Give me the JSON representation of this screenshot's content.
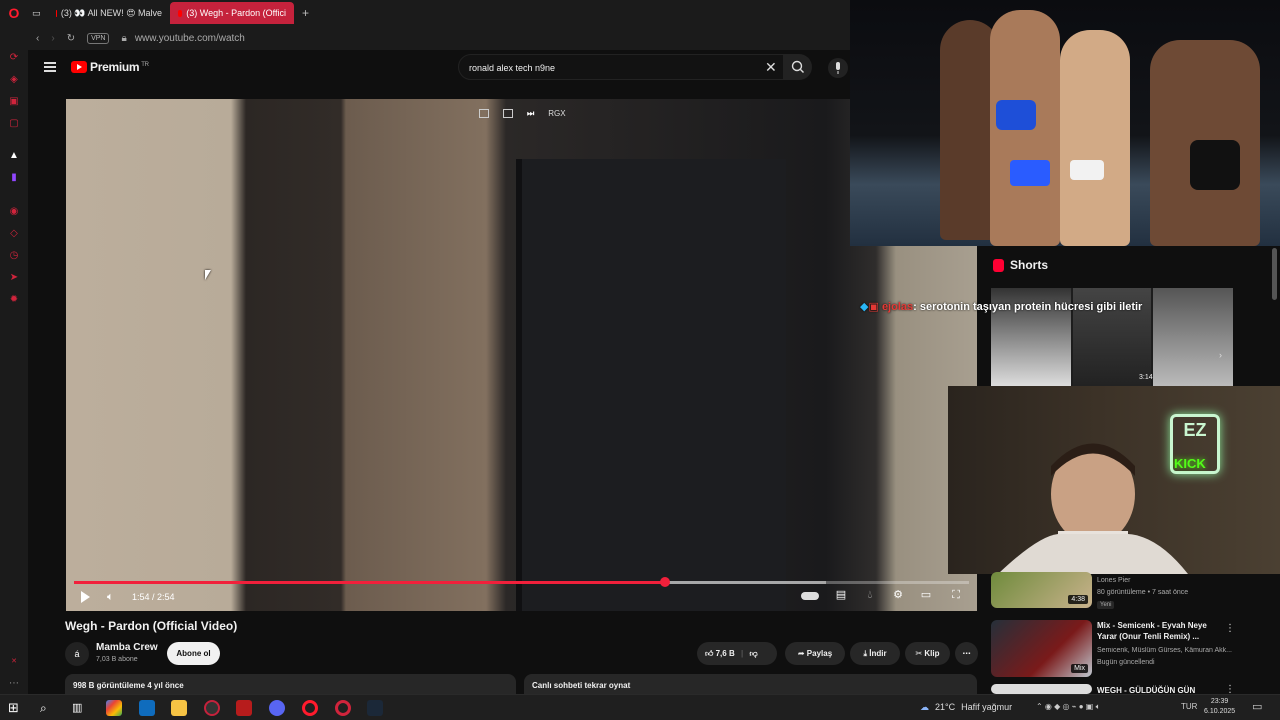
{
  "browser": {
    "tabs": [
      {
        "label": "(3) 👀 All NEW! 😍 Malve"
      },
      {
        "label": "(3) Wegh - Pardon (Offici"
      }
    ],
    "new_tab": "+",
    "vpn_label": "VPN",
    "url": "www.youtube.com/watch"
  },
  "youtube": {
    "brand": "Premium",
    "region": "TR",
    "search_value": "ronald alex tech n9ne"
  },
  "player": {
    "pip_label": "RGX",
    "time": "1:54 / 2:54",
    "progress_fraction": 0.66,
    "buffer_fraction": 0.84
  },
  "video": {
    "title": "Wegh - Pardon (Official Video)",
    "channel": "Mamba Crew",
    "channel_avatar": "á",
    "subscribers": "7,03 B abone",
    "subscribe_label": "Abone ol",
    "likes": "7,6 B",
    "share_label": "Paylaş",
    "download_label": "İndir",
    "clip_label": "Klip",
    "views_date": "998 B görüntüleme  4 yıl önce",
    "live_chat": "Canlı sohbeti tekrar oynat"
  },
  "shorts": {
    "heading": "Shorts",
    "duration": "3:14"
  },
  "overlay_chat": {
    "user": "ejolas",
    "message": ": serotonin taşıyan protein hücresi gibi iletir"
  },
  "webcam_sign": {
    "logo": "EZ",
    "kick": "KICK"
  },
  "recommendations": [
    {
      "title": "",
      "channel": "Lones Pier",
      "meta": "80 görüntüleme • 7 saat önce",
      "badge": "Yeni",
      "duration": "4:38"
    },
    {
      "title": "Mix - Semicenk - Eyvah Neye Yarar (Onur Tenli Remix) ...",
      "channel": "Semicenk, Müslüm Gürses, Kâmuran Akk...",
      "meta": "Bugün güncellendi",
      "badge": "",
      "duration": "Mix"
    },
    {
      "title": "WEGH - GÜLDÜĞÜN GÜN",
      "channel": "",
      "meta": "",
      "badge": "",
      "duration": ""
    }
  ],
  "taskbar": {
    "temperature": "21°C",
    "weather": "Hafif yağmur",
    "language": "TUR",
    "time": "23:39",
    "date": "6.10.2025"
  },
  "colors": {
    "accent": "#f1203b",
    "opera_red": "#c5223c",
    "kick_green": "#53fc18"
  }
}
